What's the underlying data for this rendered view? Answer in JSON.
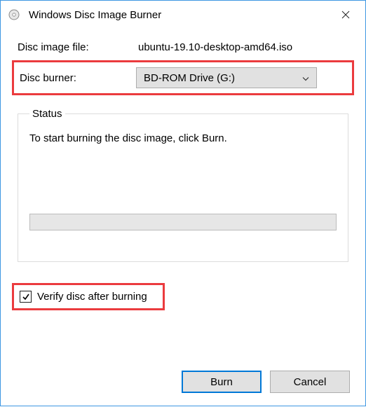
{
  "window": {
    "title": "Windows Disc Image Burner"
  },
  "labels": {
    "image_file": "Disc image file:",
    "disc_burner": "Disc burner:"
  },
  "values": {
    "image_file": "ubuntu-19.10-desktop-amd64.iso",
    "disc_burner_selected": "BD-ROM Drive (G:)"
  },
  "status": {
    "legend": "Status",
    "text": "To start burning the disc image, click Burn."
  },
  "verify": {
    "checked": true,
    "label": "Verify disc after burning"
  },
  "buttons": {
    "burn": "Burn",
    "cancel": "Cancel"
  }
}
